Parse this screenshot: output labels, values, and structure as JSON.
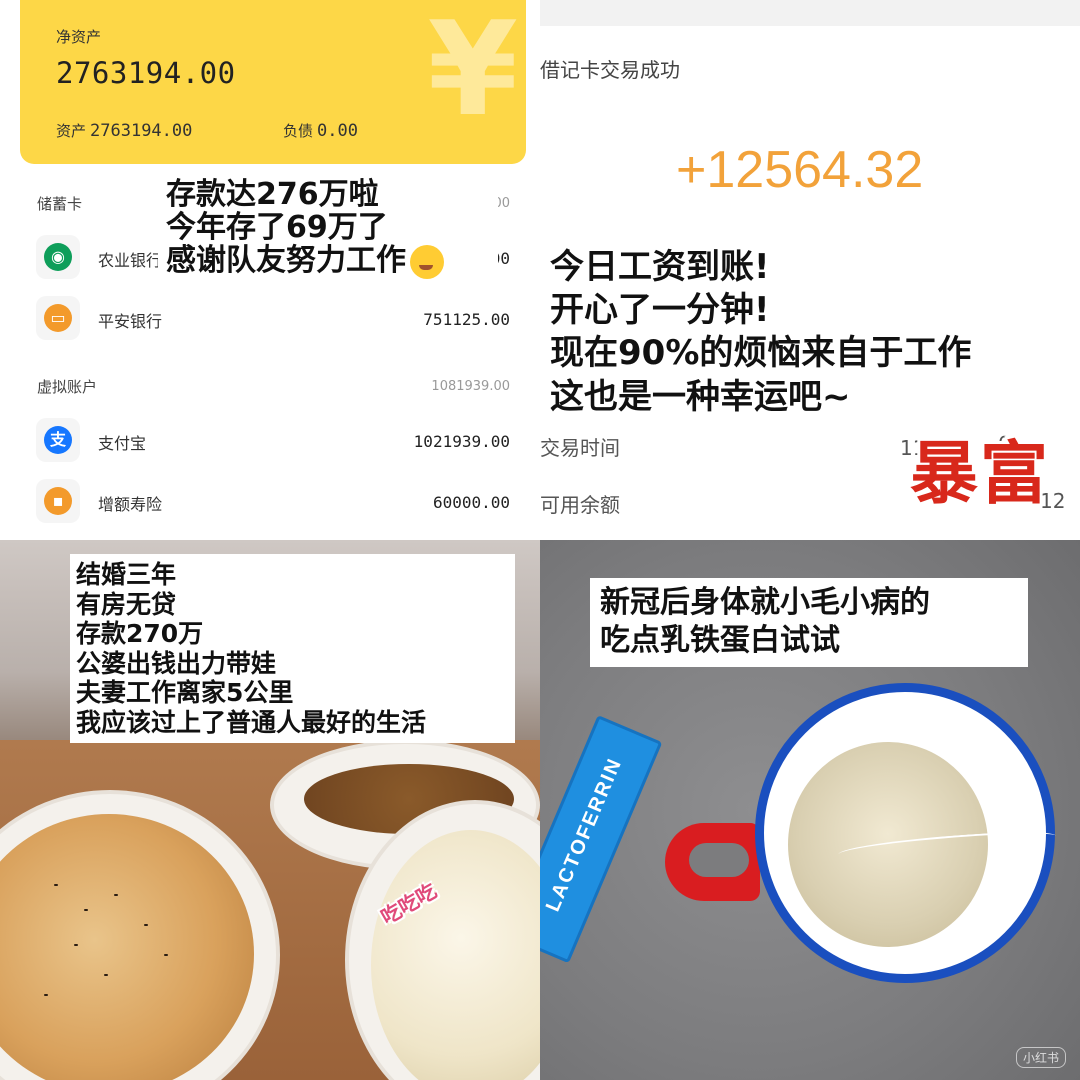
{
  "q1": {
    "net_assets_label": "净资产",
    "net_assets_value": "2763194.00",
    "assets_label": "资产",
    "assets_value": "2763194.00",
    "debt_label": "负债",
    "debt_value": "0.00",
    "yen_symbol": "¥",
    "savings_section": {
      "label": "储蓄卡",
      "total_partial": "00"
    },
    "savings_accounts": [
      {
        "name": "农业银行",
        "amount_partial": "00",
        "icon": "abc-bank-icon",
        "color": "#0e9e5a"
      },
      {
        "name": "平安银行",
        "amount": "751125.00",
        "icon": "card-icon",
        "color": "#f39a2b"
      }
    ],
    "virtual_section": {
      "label": "虚拟账户",
      "total": "1081939.00"
    },
    "virtual_accounts": [
      {
        "name": "支付宝",
        "amount": "1021939.00",
        "icon": "alipay-icon",
        "color": "#1677ff",
        "glyph": "支"
      },
      {
        "name": "增额寿险",
        "amount": "60000.00",
        "icon": "wallet-icon",
        "color": "#f39a2b"
      }
    ],
    "overlay_lines": [
      "存款达276万啦",
      "今年存了69万了",
      "感谢队友努力工作"
    ]
  },
  "q2": {
    "title": "借记卡交易成功",
    "amount": "+12564.32",
    "overlay_lines": [
      "今日工资到账!",
      "开心了一分钟!",
      "现在90%的烦恼来自于工作",
      "这也是一种幸运吧~"
    ],
    "time_label": "交易时间",
    "time_partial": "11月",
    "time_partial_2": "0",
    "balance_label": "可用余额",
    "balance_partial": "12",
    "sticker": "暴富"
  },
  "q3": {
    "overlay_lines": [
      "结婚三年",
      "有房无贷",
      "存款270万",
      "公婆出钱出力带娃",
      "夫妻工作离家5公里",
      "我应该过上了普通人最好的生活"
    ],
    "food_sticker": "吃吃吃"
  },
  "q4": {
    "overlay_lines": [
      "新冠后身体就小毛小病的",
      "吃点乳铁蛋白试试"
    ],
    "sachet_brand": "LACTOFERRIN",
    "watermark": "小红书"
  },
  "colors": {
    "card_yellow": "#fdd747",
    "amount_orange": "#f2a23a",
    "sticker_red": "#d8281b",
    "mug_blue": "#1a4fbf",
    "mug_red": "#d91d20",
    "sachet_blue": "#1f8fe0"
  }
}
